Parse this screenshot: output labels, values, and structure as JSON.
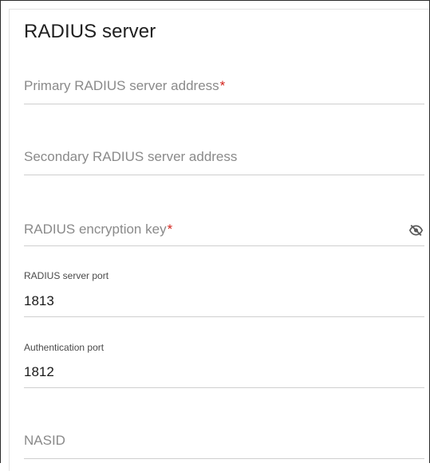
{
  "section": {
    "title": "RADIUS server"
  },
  "fields": {
    "primary_address": {
      "placeholder": "Primary RADIUS server address",
      "required_mark": "*"
    },
    "secondary_address": {
      "placeholder": "Secondary RADIUS server address"
    },
    "encryption_key": {
      "placeholder": "RADIUS encryption key",
      "required_mark": "*",
      "visibility_icon": "eye-slash-icon"
    },
    "server_port": {
      "label": "RADIUS server port",
      "value": "1813"
    },
    "auth_port": {
      "label": "Authentication port",
      "value": "1812"
    },
    "nasid": {
      "placeholder": "NASID"
    }
  },
  "colors": {
    "required": "#d3231c",
    "placeholder": "#8a8a8a",
    "underline": "#cfcfcf"
  }
}
